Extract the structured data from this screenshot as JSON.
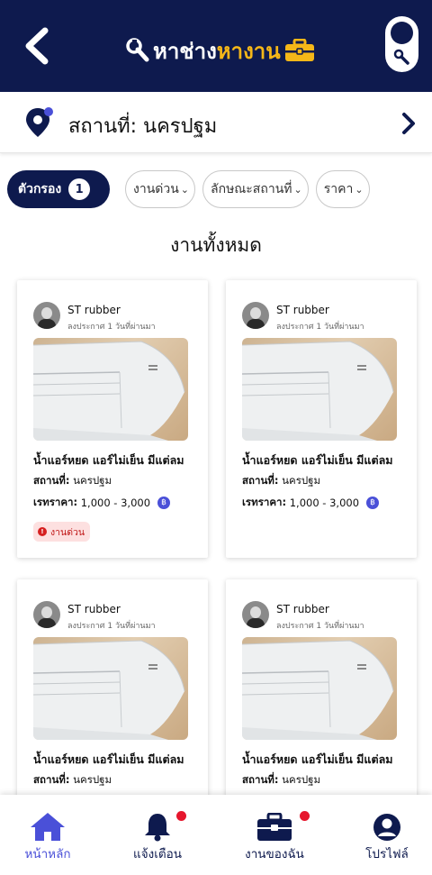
{
  "header": {
    "logo_part1": "หาช่าง",
    "logo_part2": "หางาน"
  },
  "location": {
    "label": "สถานที่: นครปฐม"
  },
  "filters": {
    "main_label": "ตัวกรอง",
    "active_count": "1",
    "chips": [
      "งานด่วน",
      "ลักษณะสถานที่",
      "ราคา"
    ]
  },
  "section_title": "งานทั้งหมด",
  "jobs": [
    {
      "poster_name": "ST rubber",
      "posted_time": "ลงประกาศ 1 วันที่ผ่านมา",
      "title": "น้ำแอร์หยด แอร์ไม่เย็น มีแต่ลม",
      "location_label": "สถานที่:",
      "location_value": "นครปฐม",
      "price_label": "เรทราคา:",
      "price_value": "1,000 - 3,000",
      "currency_symbol": "฿",
      "urgent_label": "งานด่วน"
    },
    {
      "poster_name": "ST rubber",
      "posted_time": "ลงประกาศ 1 วันที่ผ่านมา",
      "title": "น้ำแอร์หยด แอร์ไม่เย็น มีแต่ลม",
      "location_label": "สถานที่:",
      "location_value": "นครปฐม",
      "price_label": "เรทราคา:",
      "price_value": "1,000 - 3,000",
      "currency_symbol": "฿"
    },
    {
      "poster_name": "ST rubber",
      "posted_time": "ลงประกาศ 1 วันที่ผ่านมา",
      "title": "น้ำแอร์หยด แอร์ไม่เย็น มีแต่ลม",
      "location_label": "สถานที่:",
      "location_value": "นครปฐม"
    },
    {
      "poster_name": "ST rubber",
      "posted_time": "ลงประกาศ 1 วันที่ผ่านมา",
      "title": "น้ำแอร์หยด แอร์ไม่เย็น มีแต่ลม",
      "location_label": "สถานที่:",
      "location_value": "นครปฐม"
    }
  ],
  "bottom_nav": {
    "home": "หน้าหลัก",
    "notifications": "แจ้งเตือน",
    "my_jobs": "งานของฉัน",
    "profile": "โปรไฟล์"
  },
  "colors": {
    "primary": "#0e1a4e",
    "accent": "#f5b718",
    "active": "#4a50d8",
    "alert": "#e6162d"
  }
}
